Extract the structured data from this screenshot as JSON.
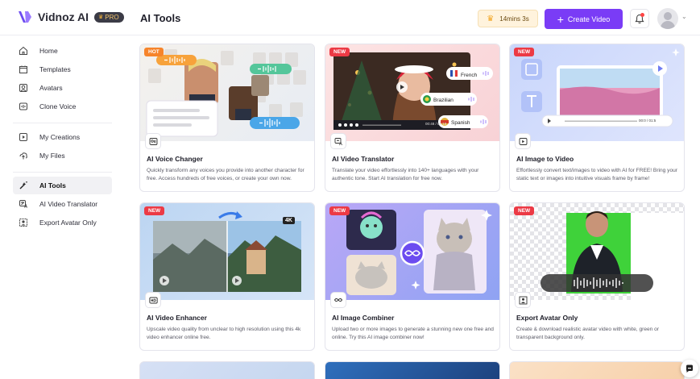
{
  "brand": {
    "name": "Vidnoz AI",
    "badge": "PRO"
  },
  "header": {
    "title": "AI Tools",
    "time_remaining": "14mins 3s",
    "create_label": "Create Video"
  },
  "sidebar": {
    "groups": [
      [
        {
          "label": "Home",
          "icon": "home-icon"
        },
        {
          "label": "Templates",
          "icon": "templates-icon"
        },
        {
          "label": "Avatars",
          "icon": "avatar-icon"
        },
        {
          "label": "Clone Voice",
          "icon": "voice-icon"
        }
      ],
      [
        {
          "label": "My Creations",
          "icon": "play-icon"
        },
        {
          "label": "My Files",
          "icon": "upload-icon"
        }
      ],
      [
        {
          "label": "AI Tools",
          "icon": "tools-icon",
          "active": true
        },
        {
          "label": "AI Video Translator",
          "icon": "translate-icon"
        },
        {
          "label": "Export Avatar Only",
          "icon": "avatar-export-icon"
        }
      ]
    ]
  },
  "cards": [
    {
      "tag": "HOT",
      "title": "AI Voice Changer",
      "desc": "Quickly transform any voices you provide into another character for free. Access hundreds of free voices, or create your own now."
    },
    {
      "tag": "NEW",
      "title": "AI Video Translator",
      "desc": "Translate your video effortlessly into 140+ languages with your authentic tone. Start AI translation for free now.",
      "languages": [
        "French",
        "Brazilian",
        "Spanish"
      ],
      "player_time": "00:48 / 01:18"
    },
    {
      "tag": "NEW",
      "title": "AI Image to Video",
      "desc": "Effortlessly convert text/images to video with AI for FREE! Bring your static text or images into intuitive visuals frame by frame!",
      "player_time": "00:0 / 01:5"
    },
    {
      "tag": "NEW",
      "title": "AI Video Enhancer",
      "desc": "Upscale video quality from unclear to high resolution using this 4k video enhancer online free.",
      "resolution_badge": "4K"
    },
    {
      "tag": "NEW",
      "title": "AI Image Combiner",
      "desc": "Upload two or more images to generate a stunning new one free and online. Try this AI image combiner now!"
    },
    {
      "tag": "NEW",
      "title": "Export Avatar Only",
      "desc": "Create & download realistic avatar video with white, green or transparent background only."
    }
  ],
  "colors": {
    "accent": "#7a3cf6",
    "hot": "#f6842b",
    "new": "#ec3a45"
  }
}
